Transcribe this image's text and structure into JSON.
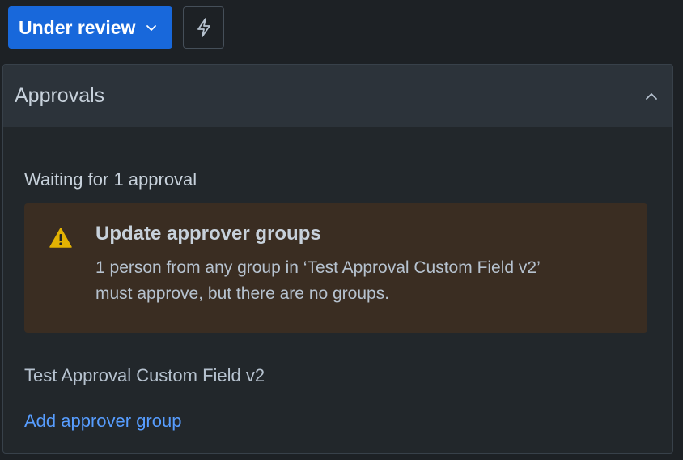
{
  "toolbar": {
    "status_label": "Under review",
    "status_icon": "chevron-down-icon",
    "action_icon": "lightning-bolt-icon"
  },
  "approvals": {
    "title": "Approvals",
    "collapse_icon": "chevron-up-icon",
    "waiting_text": "Waiting for 1 approval",
    "warning": {
      "icon": "warning-icon",
      "title": "Update approver groups",
      "line1": "1 person from any group in ‘Test Approval Custom Field v2’",
      "line2": "must approve, but there are no groups."
    },
    "field_name": "Test Approval Custom Field v2",
    "add_link": "Add approver group"
  },
  "colors": {
    "background": "#1d2125",
    "status_button": "#1868db",
    "warning_bg": "#3a2d22",
    "warning_icon": "#e2b203",
    "link": "#579dff"
  }
}
